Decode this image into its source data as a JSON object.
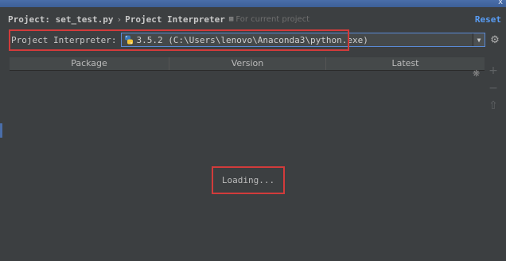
{
  "window": {
    "close_glyph": "x"
  },
  "header": {
    "project": "Project: set_test.py",
    "separator": "›",
    "section": "Project Interpreter",
    "scope_icon": "copy-icon",
    "scope_text": "For current project",
    "reset_label": "Reset"
  },
  "interpreter": {
    "label": "Project Interpreter:",
    "value": "3.5.2 (C:\\Users\\lenovo\\Anaconda3\\python.exe)",
    "icon": "python-icon",
    "dropdown_icon": "chevron-down-icon",
    "settings_icon": "gear-icon"
  },
  "table": {
    "columns": [
      "Package",
      "Version",
      "Latest"
    ],
    "status": "Loading..."
  },
  "side_toolbar": {
    "add_icon": "plus-icon",
    "remove_icon": "minus-icon",
    "upgrade_icon": "arrow-up-icon"
  },
  "colors": {
    "background": "#3c3f41",
    "accent": "#589df6",
    "highlight_box": "#d23b3b",
    "combo_border": "#5a8ad6"
  }
}
